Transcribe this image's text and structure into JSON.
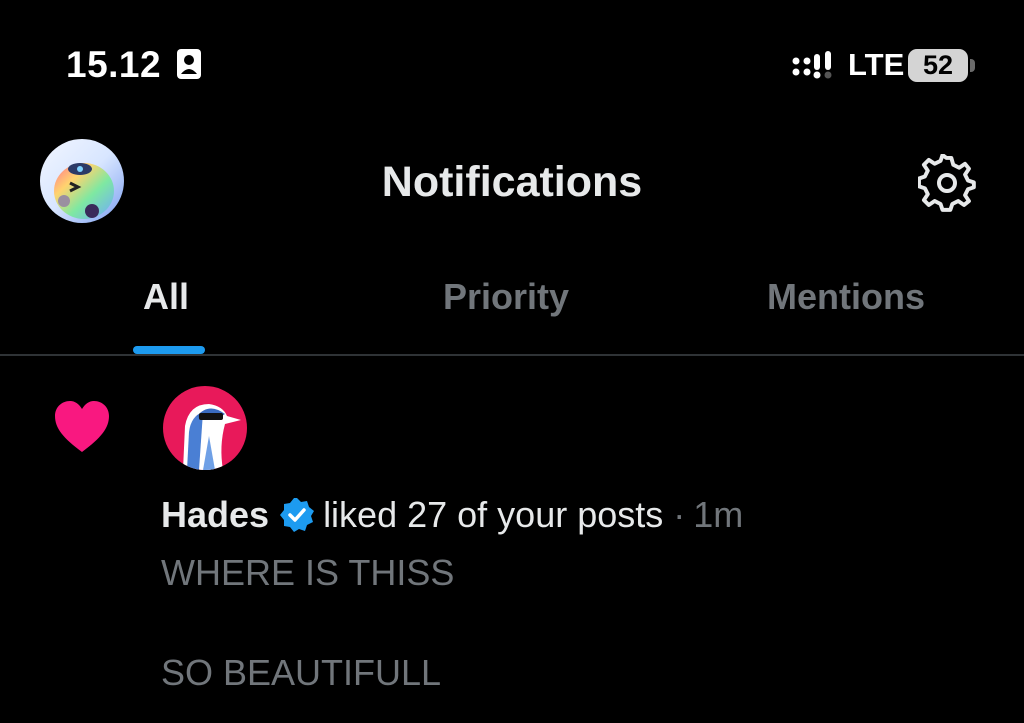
{
  "status_bar": {
    "time": "15.12",
    "network": "LTE",
    "battery": "52",
    "icons": [
      "id-card-icon",
      "signal-icon",
      "battery-icon"
    ]
  },
  "header": {
    "title": "Notifications",
    "avatar_icon": "profile-avatar",
    "settings_icon": "gear-icon"
  },
  "tabs": [
    {
      "label": "All",
      "active": true
    },
    {
      "label": "Priority",
      "active": false
    },
    {
      "label": "Mentions",
      "active": false
    }
  ],
  "colors": {
    "accent": "#1d9bf0",
    "like": "#f91880",
    "muted": "#71767b",
    "text": "#e7e9ea",
    "background": "#000000"
  },
  "notification": {
    "type_icon": "heart-icon",
    "actor": "Hades",
    "verified": true,
    "action": "liked 27 of your posts",
    "separator": "·",
    "time": "1m",
    "post_lines": [
      "WHERE IS THISS",
      "SO BEAUTIFULL"
    ]
  }
}
